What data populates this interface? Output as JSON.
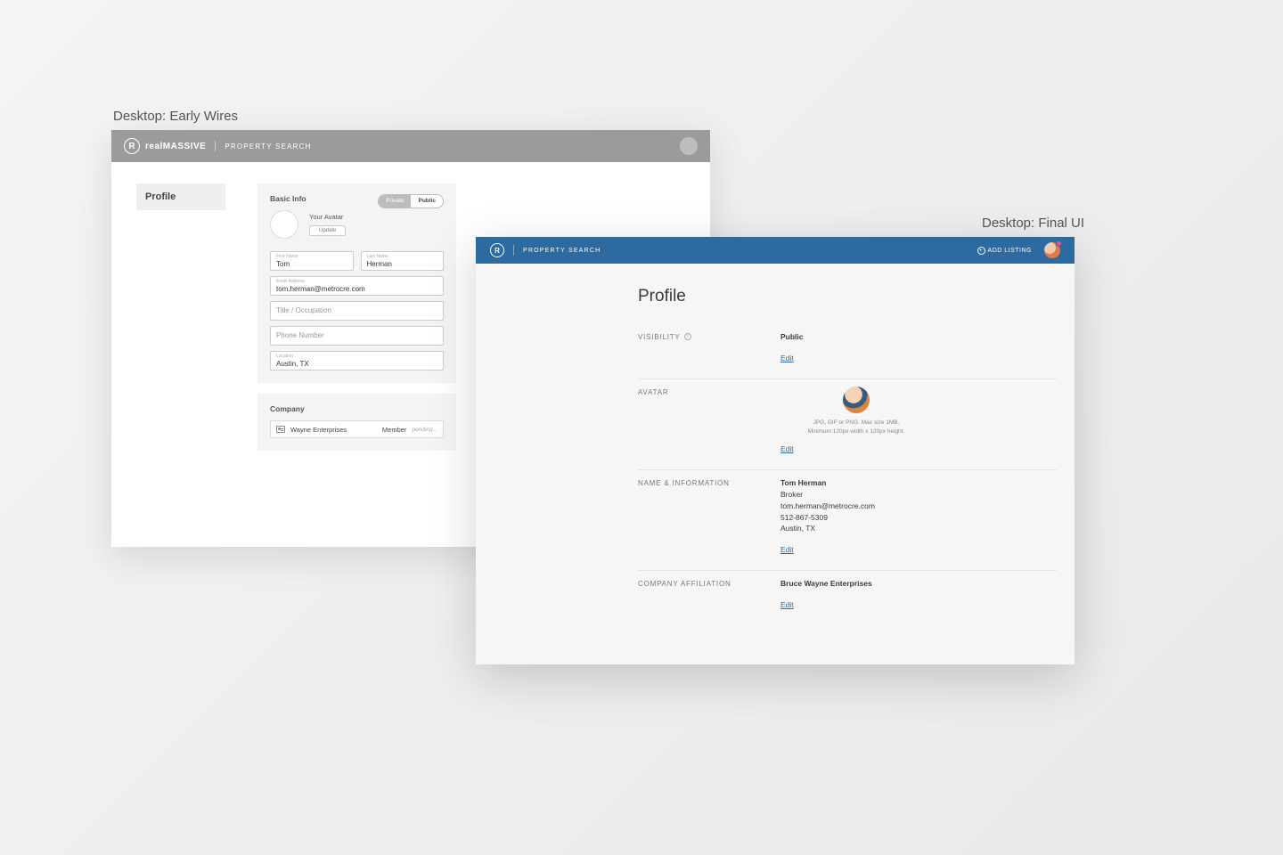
{
  "captions": {
    "wires": "Desktop: Early Wires",
    "final": "Desktop: Final UI"
  },
  "wire": {
    "brand_prefix": "Real",
    "brand_suffix": "Massive",
    "subtitle": "PROPERTY SEARCH",
    "sidebar_tab": "Profile",
    "basic_info": {
      "title": "Basic Info",
      "toggle_private": "Private",
      "toggle_public": "Public",
      "avatar_label": "Your Avatar",
      "update_btn": "Update",
      "first_name_label": "First Name",
      "first_name_value": "Tom",
      "last_name_label": "Last Name",
      "last_name_value": "Herman",
      "email_label": "Email Address",
      "email_value": "tom.herman@metrocre.com",
      "title_placeholder": "Title / Occupation",
      "phone_placeholder": "Phone Number",
      "location_label": "Location",
      "location_value": "Austin, TX"
    },
    "company": {
      "title": "Company",
      "name": "Wayne Enterprises",
      "role": "Member",
      "status": "pending..."
    }
  },
  "final": {
    "subtitle": "PROPERTY SEARCH",
    "add_listing": "ADD LISTING",
    "page_title": "Profile",
    "sections": {
      "visibility": {
        "label": "VISIBILITY",
        "value": "Public",
        "edit": "Edit"
      },
      "avatar": {
        "label": "AVATAR",
        "hint1": "JPG, GIF or PNG. Max size 1MB.",
        "hint2": "Minimum 120px width x 120px height.",
        "edit": "Edit"
      },
      "info": {
        "label": "NAME & INFORMATION",
        "name": "Tom Herman",
        "role": "Broker",
        "email": "tom.herman@metrocre.com",
        "phone": "512-867-5309",
        "location": "Austin, TX",
        "edit": "Edit"
      },
      "company": {
        "label": "COMPANY AFFILIATION",
        "value": "Bruce Wayne Enterprises",
        "edit": "Edit"
      }
    }
  }
}
